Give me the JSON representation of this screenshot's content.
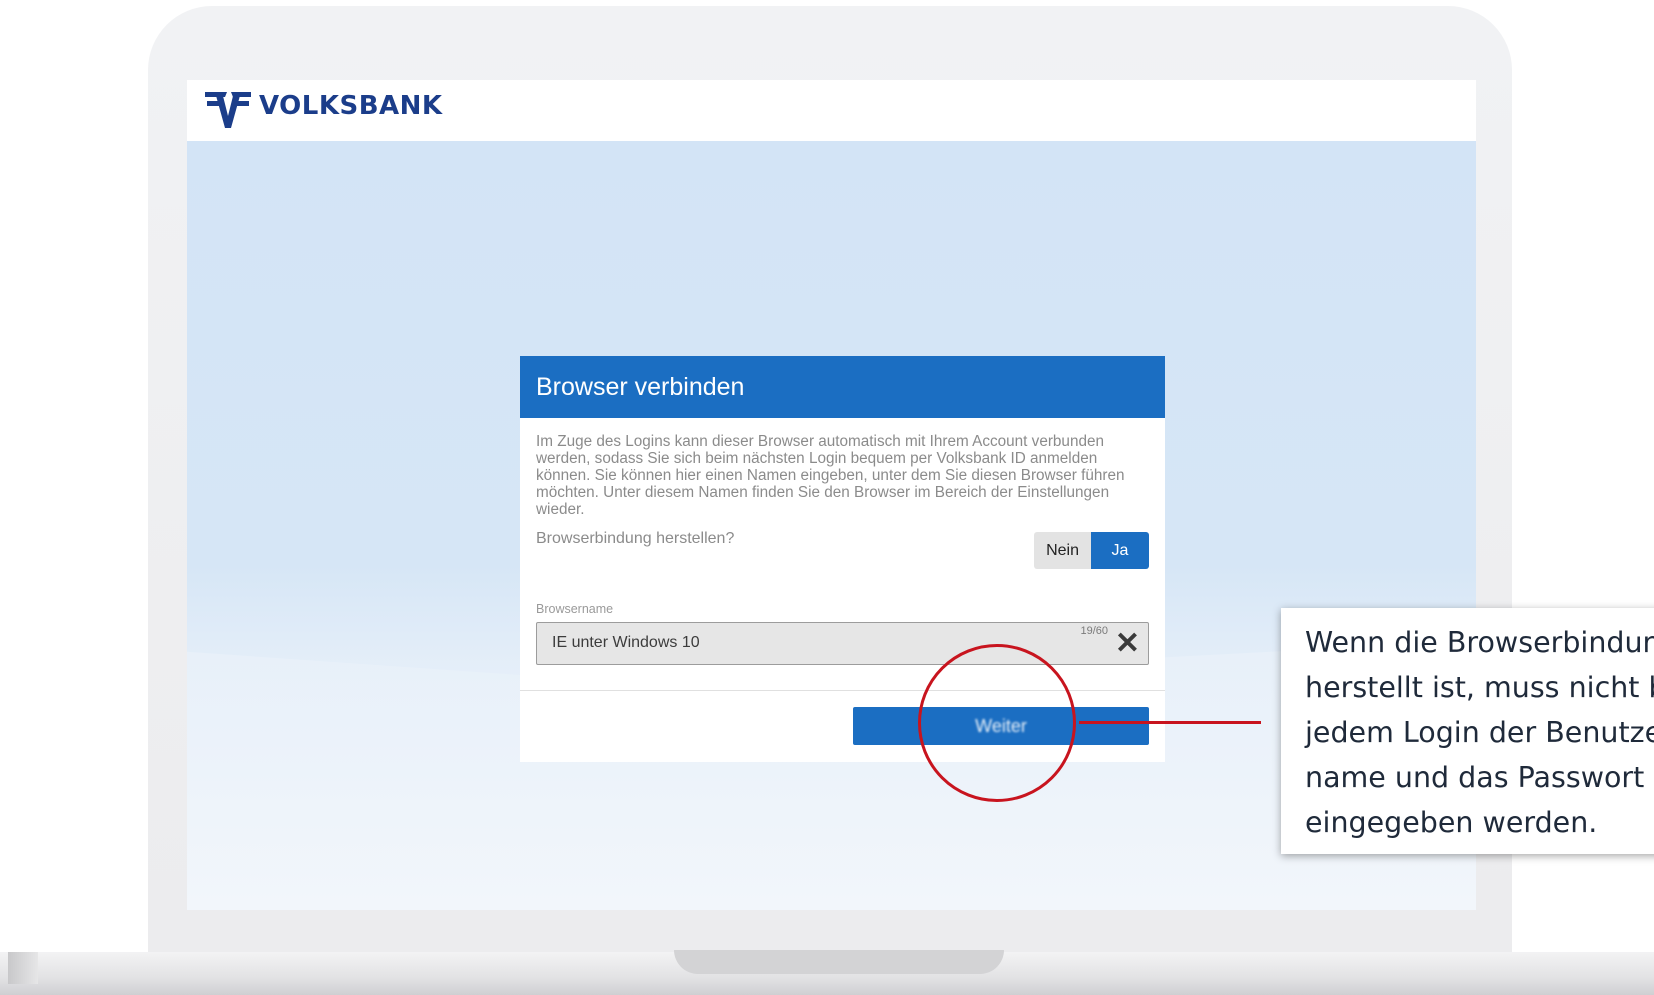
{
  "brand": {
    "name": "VOLKSBANK",
    "logo_icon": "volksbank-logo-icon",
    "color": "#1b3d8a"
  },
  "dialog": {
    "title": "Browser verbinden",
    "intro": "Im Zuge des Logins kann dieser Browser automatisch mit Ihrem Account verbunden werden, sodass Sie sich beim nächsten Login bequem per Volksbank ID anmelden können. Sie können hier einen Namen eingeben, unter dem Sie diesen Browser führen möchten. Unter diesem Namen finden Sie den Browser im Bereich der Einstellungen wieder.",
    "question": "Browserbindung herstellen?",
    "toggle": {
      "no_label": "Nein",
      "yes_label": "Ja",
      "selected": "Ja"
    },
    "field": {
      "label": "Browsername",
      "value": "IE unter Windows 10",
      "counter": "19/60",
      "clear_icon": "close-icon"
    },
    "primary_button": "Weiter",
    "accent_color": "#1b6ec2"
  },
  "callout": {
    "text": "Wenn die Browserbindung\nherstellt ist, muss nicht bei\njedem Login der Benutzer-\nname und das Passwort\neingegeben werden.",
    "highlight_color": "#c8141e"
  }
}
